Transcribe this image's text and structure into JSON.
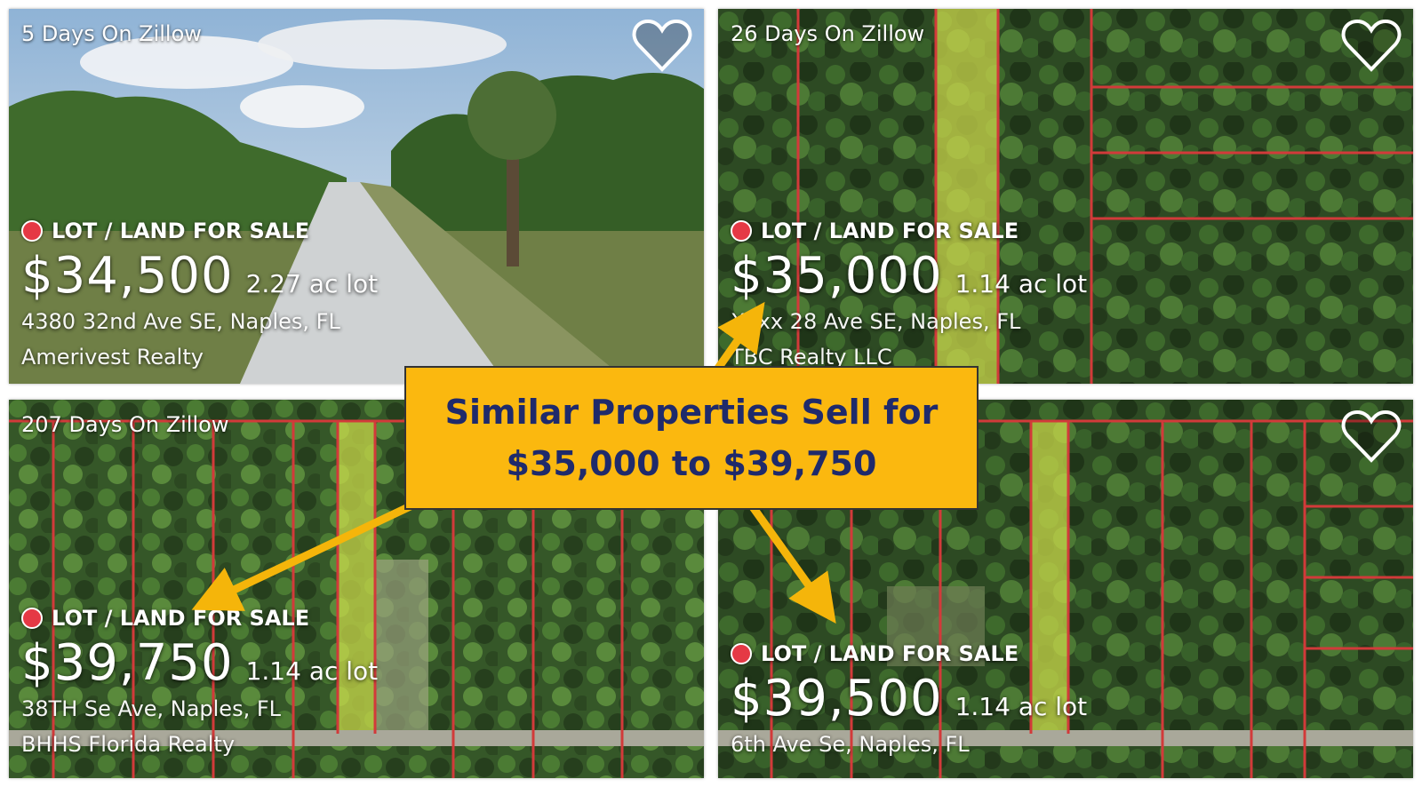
{
  "listings": [
    {
      "days": "5 Days On Zillow",
      "status": "LOT / LAND FOR SALE",
      "price": "$34,500",
      "lot_size": "2.27 ac lot",
      "address": "4380 32nd Ave SE, Naples, FL",
      "broker": "Amerivest Realty"
    },
    {
      "days": "26 Days On Zillow",
      "status": "LOT / LAND FOR SALE",
      "price": "$35,000",
      "lot_size": "1.14 ac lot",
      "address": "Xxxx 28 Ave SE, Naples, FL",
      "broker": "TBC Realty LLC"
    },
    {
      "days": "207 Days On Zillow",
      "status": "LOT / LAND FOR SALE",
      "price": "$39,750",
      "lot_size": "1.14 ac lot",
      "address": "38TH Se Ave, Naples, FL",
      "broker": "BHHS Florida Realty"
    },
    {
      "days": "",
      "status": "LOT / LAND FOR SALE",
      "price": "$39,500",
      "lot_size": "1.14 ac lot",
      "address": "6th Ave Se, Naples, FL",
      "broker": ""
    }
  ],
  "callout": {
    "line1": "Similar Properties Sell for",
    "line2": "$35,000 to $39,750"
  },
  "colors": {
    "callout_bg": "#fbb80f",
    "callout_text": "#1f2a6b",
    "status_dot": "#e53945",
    "arrow": "#f5b50a"
  },
  "icons": {
    "favorite": "heart-outline-icon",
    "status": "red-dot-icon"
  }
}
